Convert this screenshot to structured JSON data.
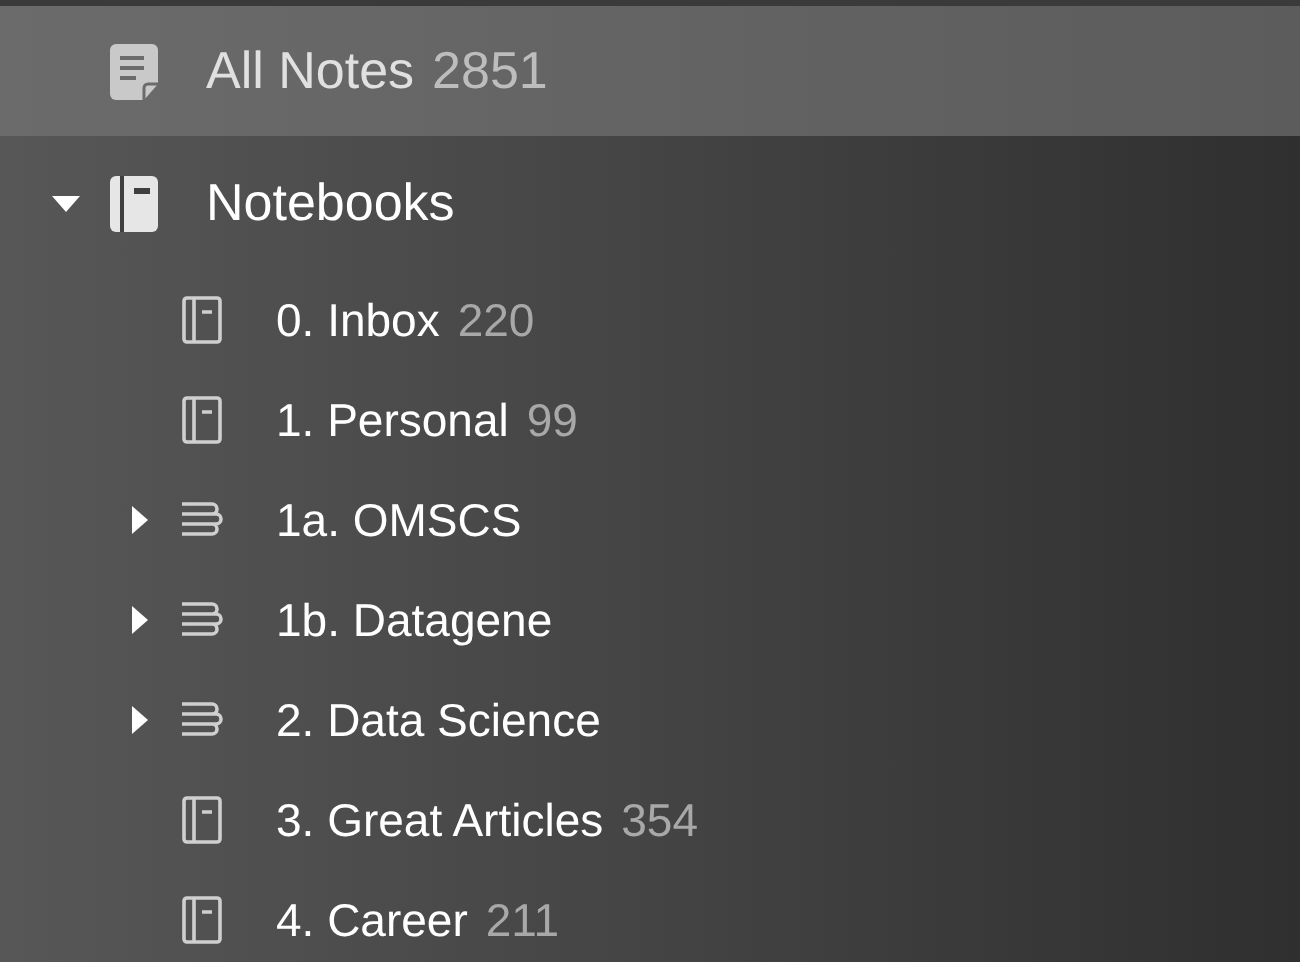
{
  "sidebar": {
    "items": [
      {
        "kind": "all_notes",
        "label": "All Notes",
        "count": "2851",
        "selected": true
      },
      {
        "kind": "section",
        "label": "Notebooks",
        "selected": false,
        "expanded": true,
        "children": [
          {
            "kind": "notebook",
            "label": "0. Inbox",
            "count": "220",
            "selected": false
          },
          {
            "kind": "notebook",
            "label": "1. Personal",
            "count": "99",
            "selected": false
          },
          {
            "kind": "stack",
            "label": "1a. OMSCS",
            "expanded": false,
            "selected": false
          },
          {
            "kind": "stack",
            "label": "1b. Datagene",
            "expanded": false,
            "selected": false
          },
          {
            "kind": "stack",
            "label": "2. Data Science",
            "expanded": false,
            "selected": false
          },
          {
            "kind": "notebook",
            "label": "3. Great Articles",
            "count": "354",
            "selected": false
          },
          {
            "kind": "notebook",
            "label": "4. Career",
            "count": "211",
            "selected": false
          }
        ]
      }
    ]
  }
}
